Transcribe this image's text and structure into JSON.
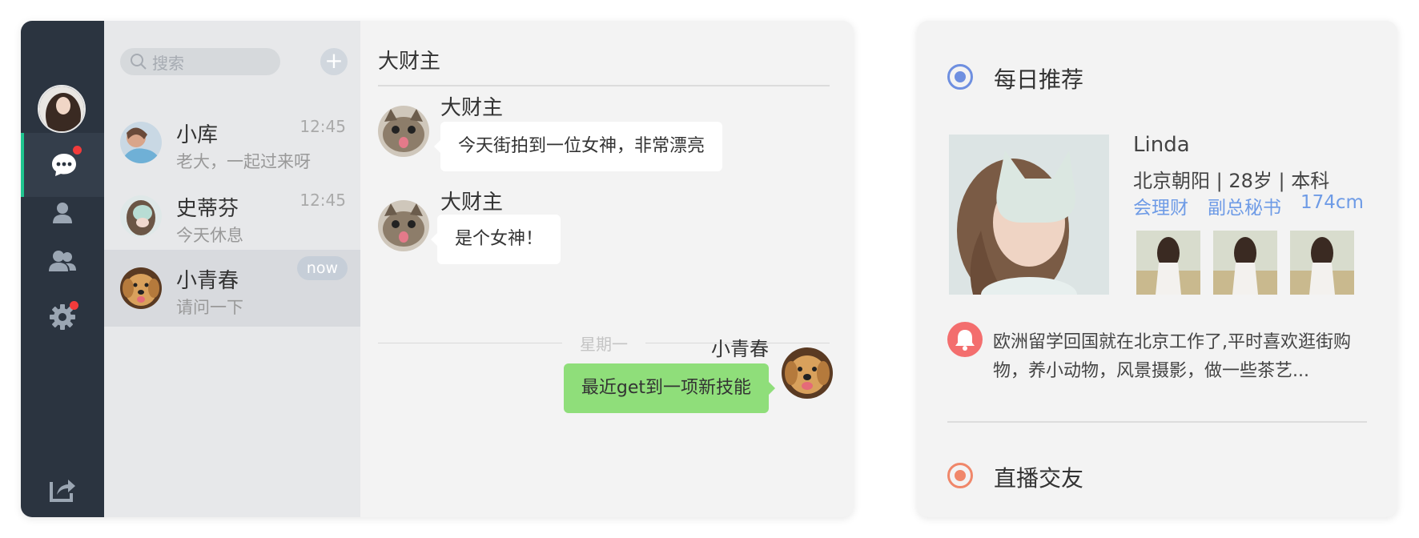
{
  "sidebar": {
    "icons": [
      "chat-icon",
      "contact-icon",
      "group-icon",
      "settings-icon",
      "logout-icon"
    ]
  },
  "contacts": {
    "search_placeholder": "搜索",
    "add_label": "+",
    "items": [
      {
        "name": "小库",
        "preview": "老大，一起过来呀",
        "time": "12:45"
      },
      {
        "name": "史蒂芬",
        "preview": "今天休息",
        "time": "12:45"
      },
      {
        "name": "小青春",
        "preview": "请问一下",
        "badge": "now"
      }
    ]
  },
  "chat": {
    "title": "大财主",
    "messages": [
      {
        "sender": "大财主",
        "text": "今天街拍到一位女神，非常漂亮"
      },
      {
        "sender": "大财主",
        "text": "是个女神！"
      },
      {
        "sender": "小青春",
        "text": "最近get到一项新技能"
      }
    ],
    "day_separator": "星期一"
  },
  "recommend": {
    "daily_title": "每日推荐",
    "profile": {
      "name": "Linda",
      "info": "北京朝阳 | 28岁 | 本科",
      "tags": [
        "会理财",
        "副总秘书",
        "174cm"
      ],
      "description": "欧洲留学回国就在北京工作了,平时喜欢逛街购物，养小动物，风景摄影，做一些茶艺..."
    },
    "live_title": "直播交友"
  },
  "colors": {
    "rail": "#2b3440",
    "accent_green": "#1fc58f",
    "bubble_green": "#8fde7a",
    "blue_radio": "#6e8fe0",
    "orange_radio": "#f0876a",
    "bell_red": "#f36e6e"
  }
}
